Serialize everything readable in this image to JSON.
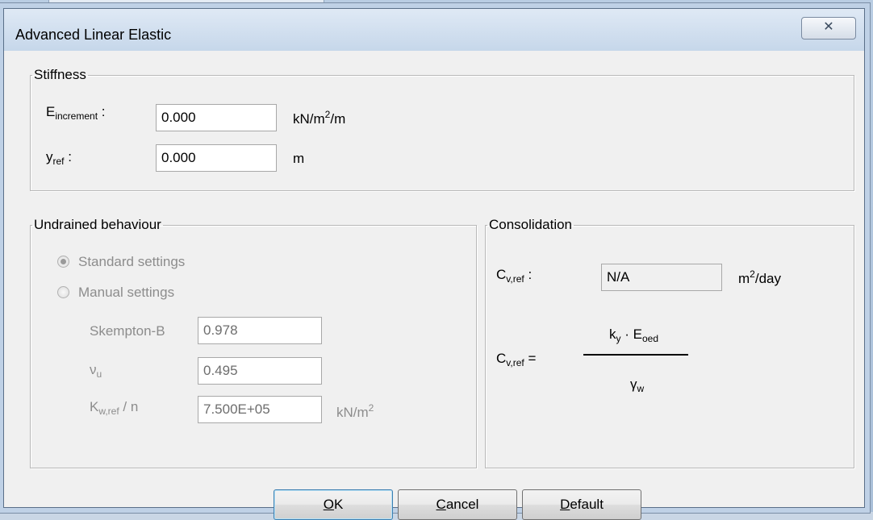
{
  "dialog": {
    "title": "Advanced Linear Elastic",
    "close_glyph": "✕"
  },
  "stiffness": {
    "legend": "Stiffness",
    "e_increment": {
      "symbol": "E",
      "sub": "increment",
      "colon": ":",
      "value": "0.000",
      "unit_main": "kN/m",
      "unit_sup": "2",
      "unit_tail": "/m"
    },
    "y_ref": {
      "symbol": "y",
      "sub": "ref",
      "colon": ":",
      "value": "0.000",
      "unit": "m"
    }
  },
  "undrained": {
    "legend": "Undrained behaviour",
    "standard_label": "Standard settings",
    "manual_label": "Manual settings",
    "selected": "standard",
    "skempton": {
      "label": "Skempton-B",
      "value": "0.978"
    },
    "nu_u": {
      "symbol": "ν",
      "sub": "u",
      "value": "0.495"
    },
    "kw": {
      "symbol": "K",
      "sub": "w,ref",
      "suffix": " / n",
      "value": "7.500E+05",
      "unit_main": "kN/m",
      "unit_sup": "2"
    }
  },
  "consolidation": {
    "legend": "Consolidation",
    "cv_label": {
      "symbol": "C",
      "sub": "v,ref",
      "colon": ":"
    },
    "cv_value": "N/A",
    "cv_unit_main": "m",
    "cv_unit_sup": "2",
    "cv_unit_tail": "/day",
    "formula": {
      "lhs_symbol": "C",
      "lhs_sub": "v,ref",
      "equals": "=",
      "num_k": "k",
      "num_k_sub": "y",
      "dot": "·",
      "num_e": "E",
      "num_e_sub": "oed",
      "den_symbol": "γ",
      "den_sub": "w"
    }
  },
  "buttons": {
    "ok_mn": "O",
    "ok_rest": "K",
    "cancel_mn": "C",
    "cancel_rest": "ancel",
    "default_mn": "D",
    "default_rest": "efault"
  }
}
